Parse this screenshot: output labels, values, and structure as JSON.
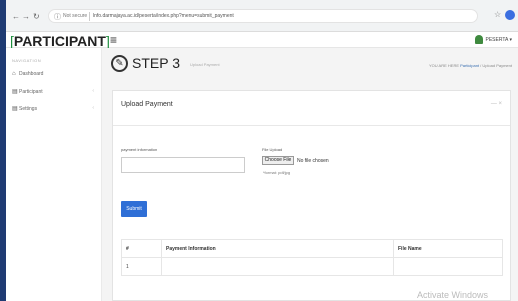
{
  "browser": {
    "security": "Not secure",
    "url": "lnfo.darmajaya.ac.id/peserta/index.php?menu=submit_payment"
  },
  "header": {
    "logo_text": "PARTICIPANT",
    "user_label": "PESERTA"
  },
  "sidebar": {
    "nav_label": "NAVIGATION",
    "items": [
      {
        "label": "Dashboard",
        "icon": "home-icon"
      },
      {
        "label": "Participant",
        "icon": "document-icon"
      },
      {
        "label": "Settings",
        "icon": "document-icon"
      }
    ]
  },
  "page": {
    "title": "STEP 3",
    "subtitle": "Upload Payment",
    "breadcrumb_prefix": "YOU ARE HERE",
    "breadcrumb": [
      "Participant",
      "Upload Payment"
    ]
  },
  "card": {
    "title": "Upload Payment",
    "tools": "— ×",
    "payment_label": "payment information",
    "payment_value": "",
    "file_label": "File Upload",
    "choose_file": "Choose File",
    "no_file": "No file chosen",
    "format_hint": "*format: pdf/jpg",
    "submit": "Submit"
  },
  "table": {
    "headers": [
      "#",
      "Payment Information",
      "File Name"
    ],
    "rows": [
      [
        "1",
        "",
        ""
      ]
    ]
  },
  "watermark": "Activate Windows"
}
